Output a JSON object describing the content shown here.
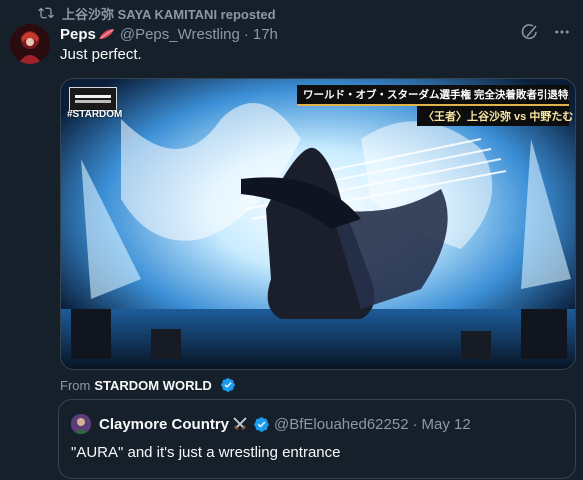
{
  "repost": {
    "label": "上谷沙弥 SAYA KAMITANI reposted",
    "icon": "repost-icon"
  },
  "tweet": {
    "display_name": "Peps",
    "emoji": "reddish-feather-emoji",
    "handle": "@Peps_Wrestling",
    "separator": "·",
    "time": "17h",
    "text": "Just perfect.",
    "actions": [
      "grok-icon",
      "more-icon"
    ],
    "media": {
      "type": "video",
      "overlay_banner_line1": "ワールド・オブ・スターダム選手権 完全決着敗者引退特別ルール",
      "overlay_banner_line2": "〈王者〉上谷沙弥 vs 中野たむ",
      "watermark": "#STARDOM",
      "logo": "stardom-logo"
    },
    "from_prefix": "From",
    "from_source": "STARDOM WORLD",
    "from_verified": true
  },
  "quote": {
    "display_name": "Claymore Country",
    "name_emoji": "crossed-swords-emoji",
    "verified": true,
    "handle": "@BfElouahed62252",
    "separator": "·",
    "time": "May 12",
    "text": "\"AURA\" and it's just a wrestling entrance"
  },
  "colors": {
    "background": "#15202b",
    "text_primary": "#f7f9f9",
    "text_secondary": "#8b98a5",
    "border": "#38444d",
    "verified_blue": "#1d9bf0"
  }
}
